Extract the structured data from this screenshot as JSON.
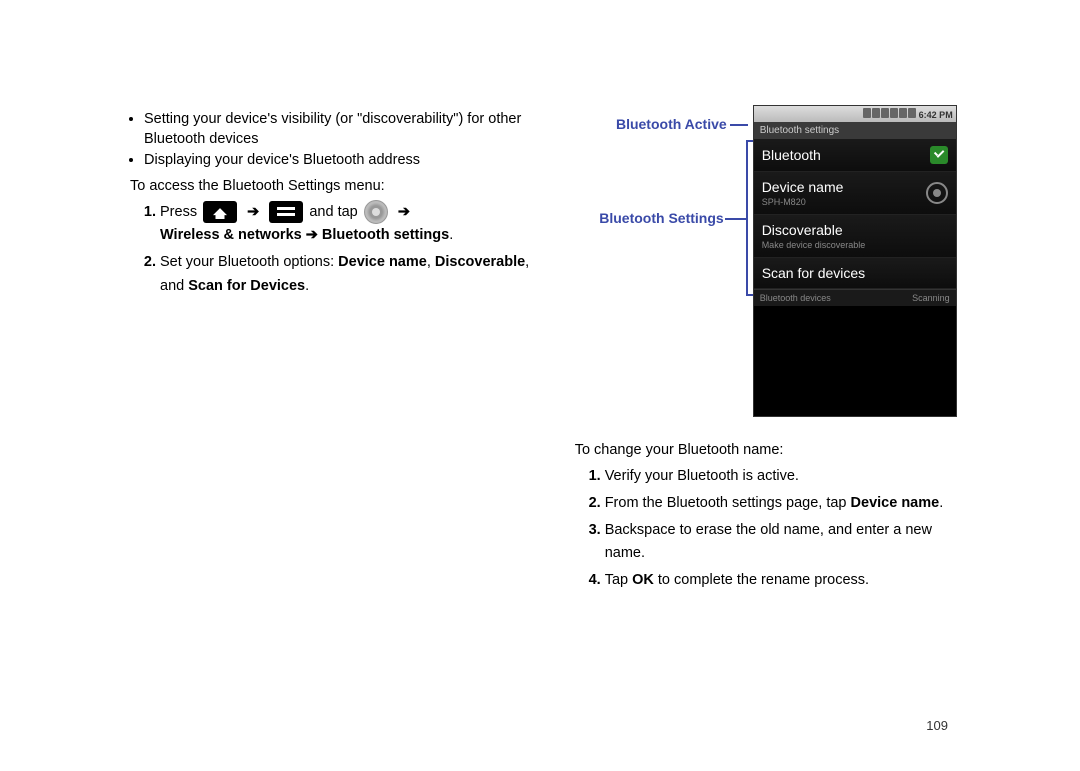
{
  "left": {
    "bullets": [
      "Setting your device's visibility (or \"discoverability\") for other Bluetooth devices",
      "Displaying your device's Bluetooth address"
    ],
    "intro": "To access the Bluetooth Settings menu:",
    "step1_press": "Press",
    "step1_andtap": "and tap",
    "step1_path": "Wireless & networks ➔ Bluetooth settings",
    "step2_a": "Set your Bluetooth options: ",
    "step2_b1": "Device name",
    "step2_c": ", ",
    "step2_b2": "Discoverable",
    "step2_d": ", and ",
    "step2_b3": "Scan for Devices",
    "step2_e": "."
  },
  "callouts": {
    "active": "Bluetooth Active",
    "settings": "Bluetooth Settings"
  },
  "phone": {
    "time": "6:42 PM",
    "titlebar": "Bluetooth settings",
    "rows": {
      "bluetooth": "Bluetooth",
      "devicename": "Device name",
      "devicename_sub": "SPH-M820",
      "discoverable": "Discoverable",
      "discoverable_sub": "Make device discoverable",
      "scan": "Scan for devices"
    },
    "footer_left": "Bluetooth devices",
    "footer_right": "Scanning"
  },
  "right": {
    "intro": "To change your Bluetooth name:",
    "steps": {
      "s1": "Verify your Bluetooth is active.",
      "s2_a": "From the Bluetooth settings page, tap ",
      "s2_b": "Device name",
      "s2_c": ".",
      "s3": "Backspace to erase the old name, and enter a new name.",
      "s4_a": "Tap ",
      "s4_b": "OK",
      "s4_c": " to complete the rename process."
    }
  },
  "page_number": "109"
}
